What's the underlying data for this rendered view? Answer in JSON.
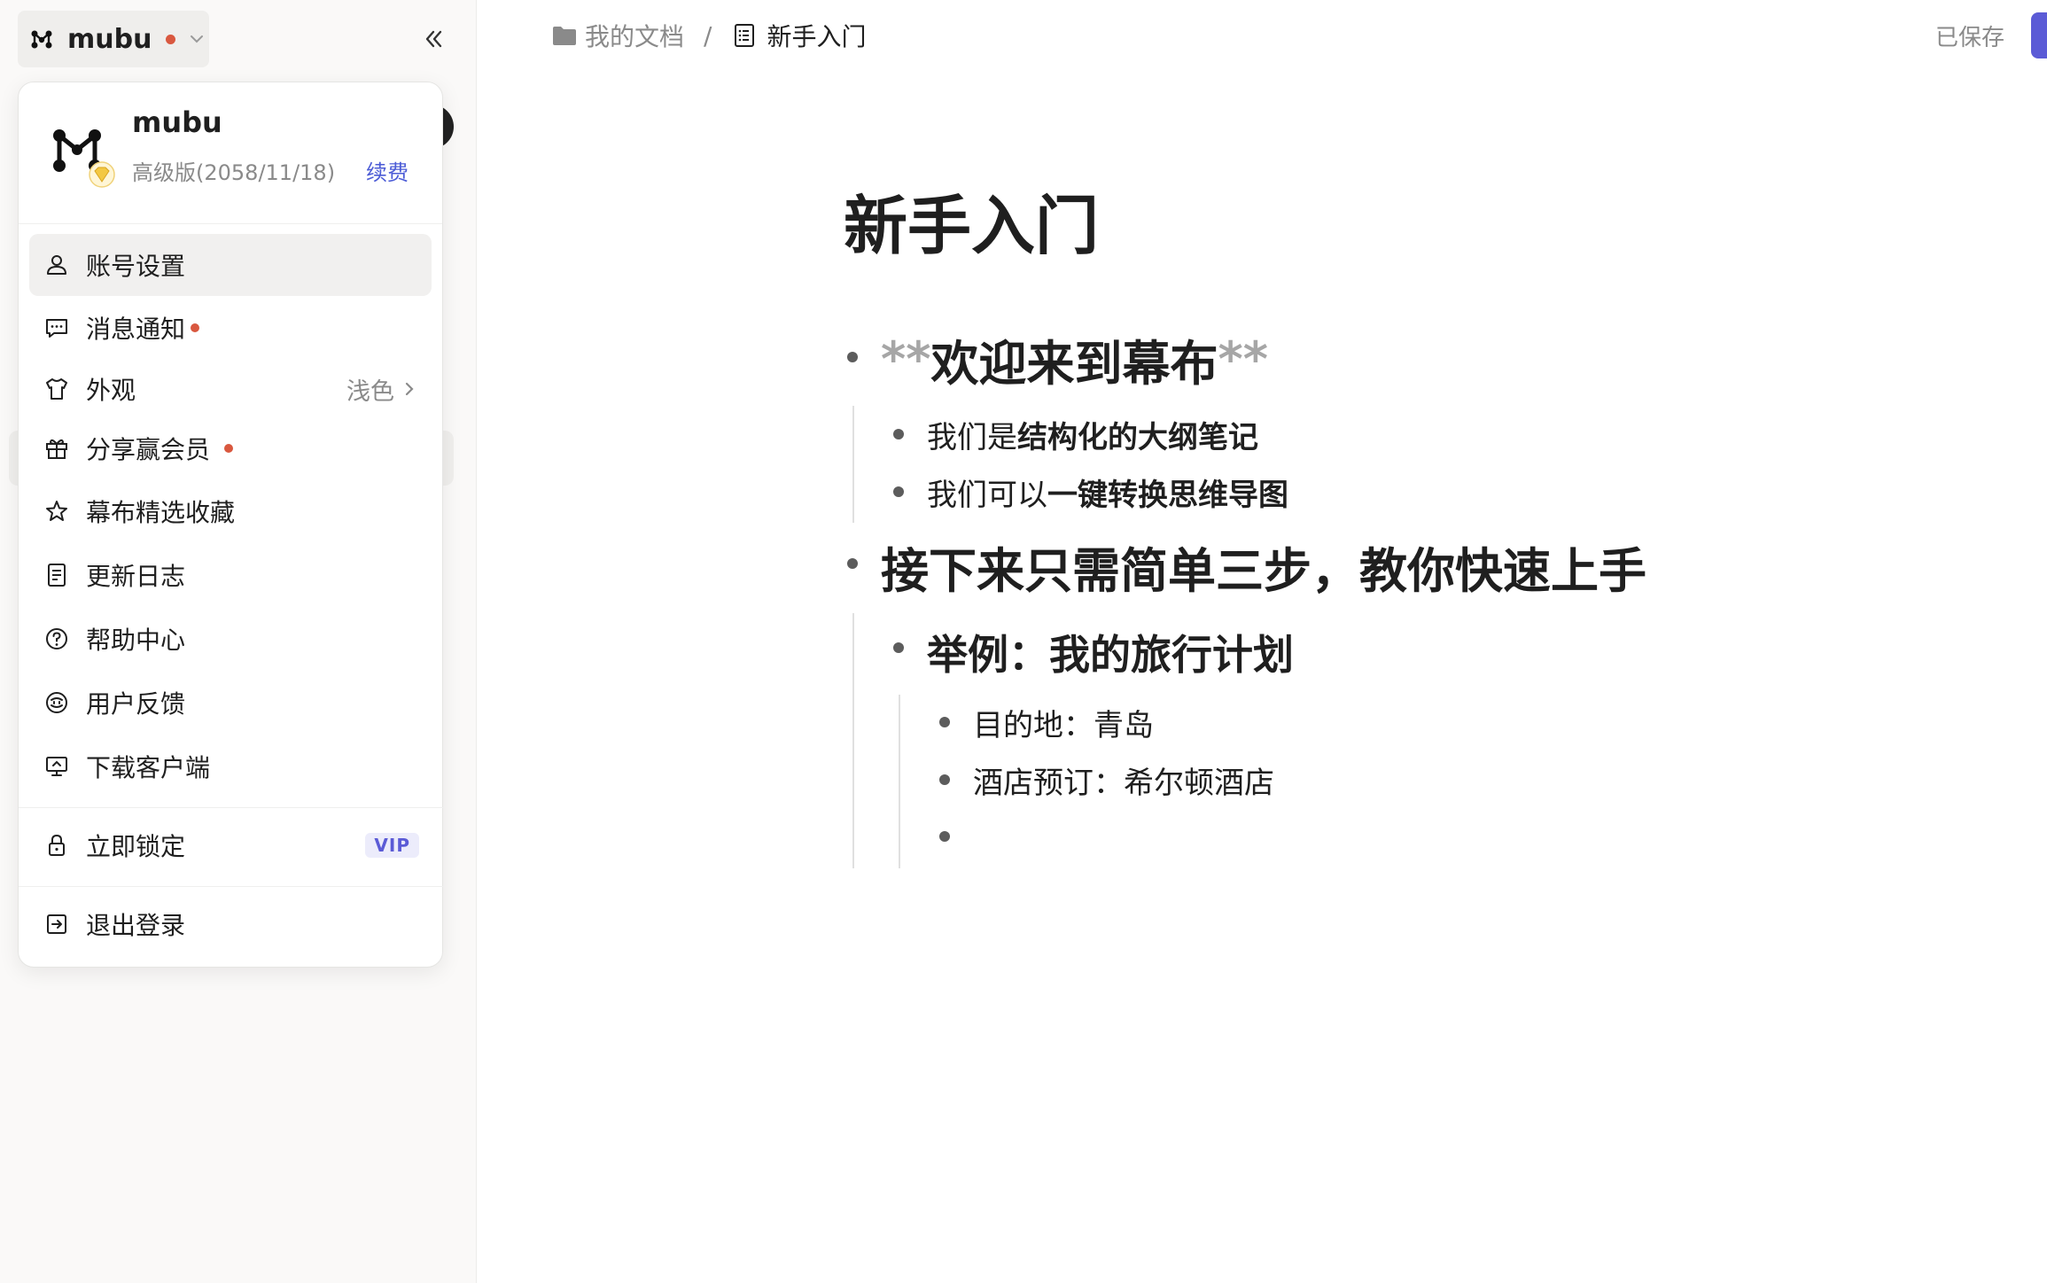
{
  "workspace": {
    "name": "mubu",
    "logo_icon": "mubu-logo-icon",
    "notification_color": "#d9583f"
  },
  "sidebar": {
    "collapse_icon": "double-chevron-left-icon"
  },
  "account_menu": {
    "user_name": "mubu",
    "plan": "高级版(2058/11/18)",
    "renew_label": "续费",
    "accent_color": "#4b5bd6",
    "items": [
      {
        "label": "账号设置",
        "icon": "user-icon"
      },
      {
        "label": "消息通知",
        "icon": "message-icon"
      },
      {
        "label": "外观",
        "icon": "shirt-icon",
        "value": "浅色"
      },
      {
        "label": "分享赢会员",
        "icon": "gift-icon"
      },
      {
        "label": "幕布精选收藏",
        "icon": "star-icon"
      },
      {
        "label": "更新日志",
        "icon": "document-icon"
      },
      {
        "label": "帮助中心",
        "icon": "help-icon"
      },
      {
        "label": "用户反馈",
        "icon": "feedback-icon"
      },
      {
        "label": "下载客户端",
        "icon": "desktop-icon"
      },
      {
        "label": "立即锁定",
        "icon": "lock-icon",
        "badge": "VIP"
      },
      {
        "label": "退出登录",
        "icon": "logout-icon"
      }
    ]
  },
  "topbar": {
    "breadcrumb": [
      {
        "label": "我的文档",
        "icon": "folder-icon"
      },
      {
        "label": "新手入门",
        "icon": "doc-list-icon"
      }
    ],
    "separator": "/",
    "save_status": "已保存"
  },
  "document": {
    "title": "新手入门",
    "outline": {
      "n1": {
        "md_open": "**",
        "text": "欢迎来到幕布",
        "md_close": "**"
      },
      "n1_1": {
        "prefix": "我们是 ",
        "bold": "结构化的大纲笔记"
      },
      "n1_2": {
        "prefix": "我们可以 ",
        "bold": "一键转换思维导图"
      },
      "n2": {
        "text": "接下来只需简单三步，教你快速上手"
      },
      "n2_1": {
        "text": "举例：我的旅行计划"
      },
      "n2_1_1": {
        "text": "目的地：青岛"
      },
      "n2_1_2": {
        "text": "酒店预订：希尔顿酒店"
      },
      "n2_1_3": {
        "text": ""
      }
    }
  }
}
